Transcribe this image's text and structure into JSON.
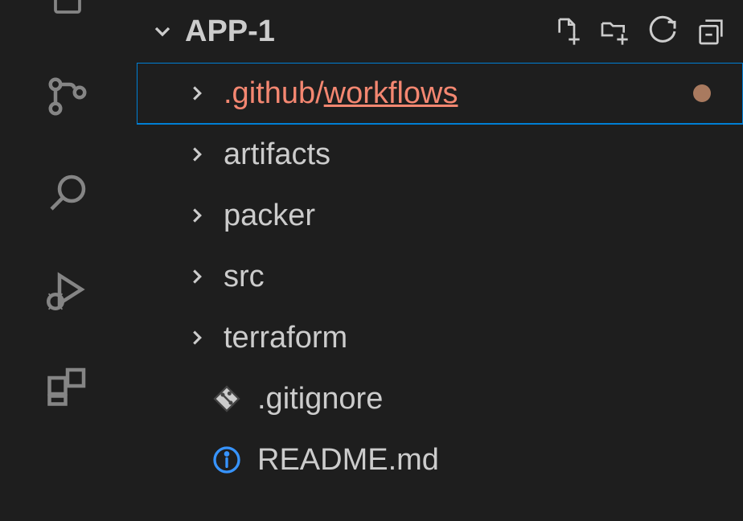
{
  "explorer": {
    "project_name": "APP-1",
    "items": [
      {
        "type": "folder-path",
        "prefix": ".github",
        "slash": "/",
        "suffix": "workflows",
        "selected": true,
        "modified": true
      },
      {
        "type": "folder",
        "label": "artifacts"
      },
      {
        "type": "folder",
        "label": "packer"
      },
      {
        "type": "folder",
        "label": "src"
      },
      {
        "type": "folder",
        "label": "terraform"
      },
      {
        "type": "file",
        "label": ".gitignore",
        "icon": "git"
      },
      {
        "type": "file",
        "label": "README.md",
        "icon": "info"
      }
    ]
  }
}
